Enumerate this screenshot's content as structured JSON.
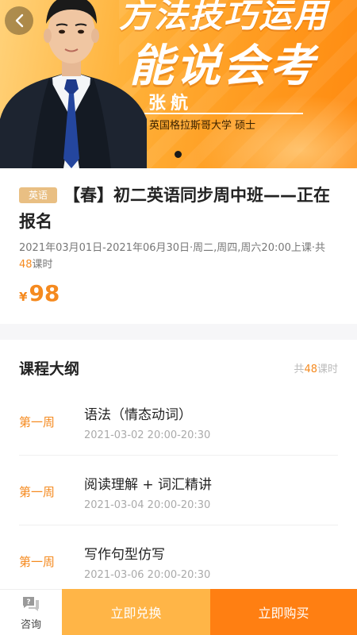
{
  "banner": {
    "headline_line1": "方法技巧运用",
    "headline_line2": "能说会考",
    "teacher_name": "张航",
    "teacher_school": "英国格拉斯哥大学  硕士",
    "carousel_dots": 1
  },
  "course": {
    "subject_tag": "英语",
    "title": "【春】初二英语同步周中班——正在报名",
    "schedule_prefix": "2021年03月01日-2021年06月30日·周二,周四,周六20:00上课·共",
    "lesson_count": "48",
    "lesson_unit": "课时",
    "price_currency": "¥",
    "price_value": "98"
  },
  "syllabus": {
    "title": "课程大纲",
    "count_prefix": "共",
    "count_value": "48",
    "count_unit": "课时",
    "lessons": [
      {
        "week": "第一周",
        "name": "语法（情态动词）",
        "time": "2021-03-02 20:00-20:30"
      },
      {
        "week": "第一周",
        "name": "阅读理解 + 词汇精讲",
        "time": "2021-03-04 20:00-20:30"
      },
      {
        "week": "第一周",
        "name": "写作句型仿写",
        "time": "2021-03-06 20:00-20:30"
      }
    ]
  },
  "bottom_bar": {
    "consult_label": "咨询",
    "exchange_label": "立即兑换",
    "buy_label": "立即购买"
  },
  "colors": {
    "accent": "#f58a1f",
    "tag": "#e9bf83",
    "exchange_button": "#ffb547",
    "buy_button": "#ff7f12"
  }
}
